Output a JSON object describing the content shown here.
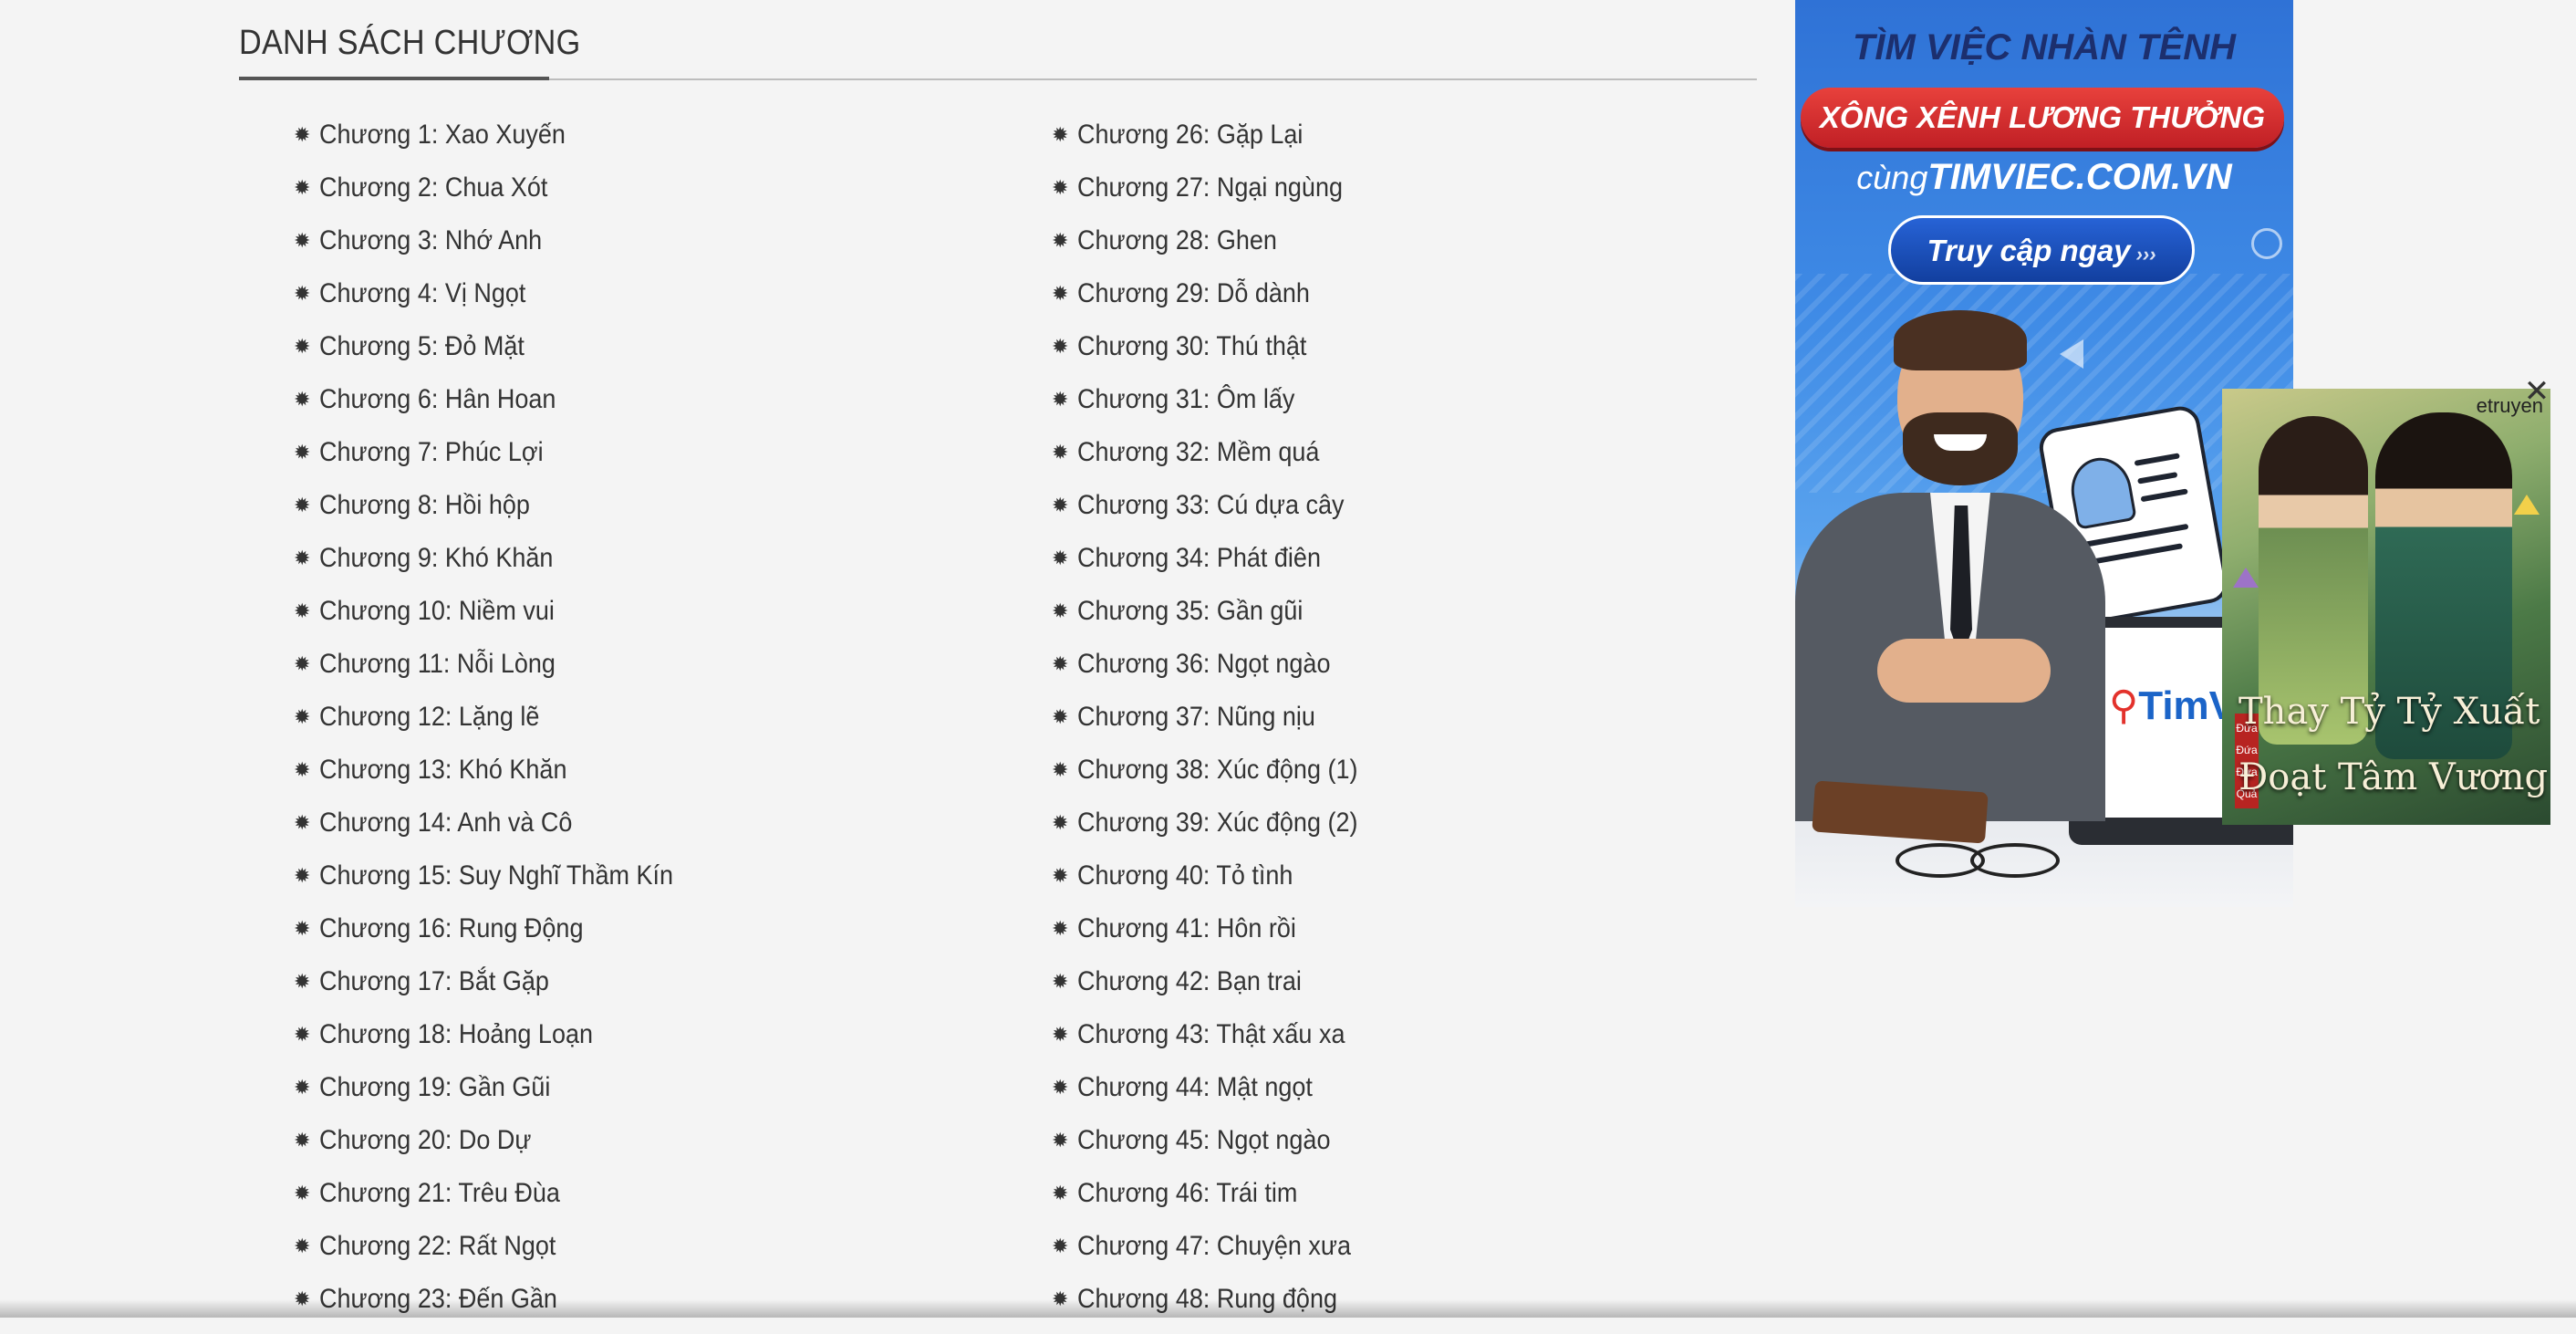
{
  "section": {
    "title": "DANH SÁCH CHƯƠNG",
    "bullet_icon": "✹"
  },
  "chapters_left": [
    "Chương 1: Xao Xuyến",
    "Chương 2: Chua Xót",
    "Chương 3: Nhớ Anh",
    "Chương 4: Vị Ngọt",
    "Chương 5: Đỏ Mặt",
    "Chương 6: Hân Hoan",
    "Chương 7: Phúc Lợi",
    "Chương 8: Hồi hộp",
    "Chương 9: Khó Khăn",
    "Chương 10: Niềm vui",
    "Chương 11: Nỗi Lòng",
    "Chương 12: Lặng lẽ",
    "Chương 13: Khó Khăn",
    "Chương 14: Anh và Cô",
    "Chương 15: Suy Nghĩ Thầm Kín",
    "Chương 16: Rung Động",
    "Chương 17: Bắt Gặp",
    "Chương 18: Hoảng Loạn",
    "Chương 19: Gần Gũi",
    "Chương 20: Do Dự",
    "Chương 21: Trêu Đùa",
    "Chương 22: Rất Ngọt",
    "Chương 23: Đến Gần"
  ],
  "chapters_right": [
    "Chương 26: Gặp Lại",
    "Chương 27: Ngại ngùng",
    "Chương 28: Ghen",
    "Chương 29: Dỗ dành",
    "Chương 30: Thú thật",
    "Chương 31: Ôm lấy",
    "Chương 32: Mềm quá",
    "Chương 33: Cú dựa cây",
    "Chương 34: Phát điên",
    "Chương 35: Gần gũi",
    "Chương 36: Ngọt ngào",
    "Chương 37: Nũng nịu",
    "Chương 38: Xúc động (1)",
    "Chương 39: Xúc động (2)",
    "Chương 40: Tỏ tình",
    "Chương 41: Hôn rồi",
    "Chương 42: Bạn trai",
    "Chương 43: Thật xấu xa",
    "Chương 44: Mật ngọt",
    "Chương 45: Ngọt ngào",
    "Chương 46: Trái tim",
    "Chương 47: Chuyện xưa",
    "Chương 48: Rung động"
  ],
  "ad_banner": {
    "headline": "TÌM VIỆC NHÀN TÊNH",
    "subheadline": "XÔNG XÊNH LƯƠNG THƯỞNG",
    "brand_prefix": "cùng",
    "brand": "TIMVIEC.COM.VN",
    "cta": "Truy cập ngay",
    "cta_arrows": "›››",
    "laptop_logo": "TimV",
    "colors": {
      "primary": "#2f72d6",
      "accent": "#e3322c"
    }
  },
  "float_ad": {
    "brand": "etruyen",
    "title_line1": "Thay Tỷ Tỷ Xuất Giá",
    "title_line2": "Đoạt Tâm Vương Gia",
    "tag_lines": [
      "Đứa",
      "Đứa",
      "Đứa",
      "Quả"
    ],
    "close_icon": "✕"
  }
}
